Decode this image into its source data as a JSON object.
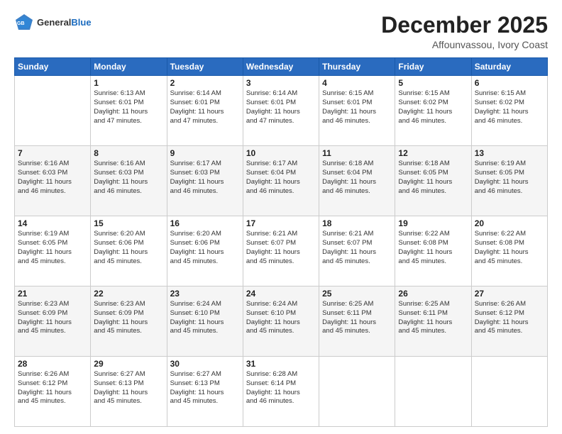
{
  "header": {
    "logo": {
      "general": "General",
      "blue": "Blue"
    },
    "title": "December 2025",
    "location": "Affounvassou, Ivory Coast"
  },
  "calendar": {
    "days_of_week": [
      "Sunday",
      "Monday",
      "Tuesday",
      "Wednesday",
      "Thursday",
      "Friday",
      "Saturday"
    ],
    "weeks": [
      [
        {
          "day": "",
          "info": ""
        },
        {
          "day": "1",
          "info": "Sunrise: 6:13 AM\nSunset: 6:01 PM\nDaylight: 11 hours\nand 47 minutes."
        },
        {
          "day": "2",
          "info": "Sunrise: 6:14 AM\nSunset: 6:01 PM\nDaylight: 11 hours\nand 47 minutes."
        },
        {
          "day": "3",
          "info": "Sunrise: 6:14 AM\nSunset: 6:01 PM\nDaylight: 11 hours\nand 47 minutes."
        },
        {
          "day": "4",
          "info": "Sunrise: 6:15 AM\nSunset: 6:01 PM\nDaylight: 11 hours\nand 46 minutes."
        },
        {
          "day": "5",
          "info": "Sunrise: 6:15 AM\nSunset: 6:02 PM\nDaylight: 11 hours\nand 46 minutes."
        },
        {
          "day": "6",
          "info": "Sunrise: 6:15 AM\nSunset: 6:02 PM\nDaylight: 11 hours\nand 46 minutes."
        }
      ],
      [
        {
          "day": "7",
          "info": "Sunrise: 6:16 AM\nSunset: 6:03 PM\nDaylight: 11 hours\nand 46 minutes."
        },
        {
          "day": "8",
          "info": "Sunrise: 6:16 AM\nSunset: 6:03 PM\nDaylight: 11 hours\nand 46 minutes."
        },
        {
          "day": "9",
          "info": "Sunrise: 6:17 AM\nSunset: 6:03 PM\nDaylight: 11 hours\nand 46 minutes."
        },
        {
          "day": "10",
          "info": "Sunrise: 6:17 AM\nSunset: 6:04 PM\nDaylight: 11 hours\nand 46 minutes."
        },
        {
          "day": "11",
          "info": "Sunrise: 6:18 AM\nSunset: 6:04 PM\nDaylight: 11 hours\nand 46 minutes."
        },
        {
          "day": "12",
          "info": "Sunrise: 6:18 AM\nSunset: 6:05 PM\nDaylight: 11 hours\nand 46 minutes."
        },
        {
          "day": "13",
          "info": "Sunrise: 6:19 AM\nSunset: 6:05 PM\nDaylight: 11 hours\nand 46 minutes."
        }
      ],
      [
        {
          "day": "14",
          "info": "Sunrise: 6:19 AM\nSunset: 6:05 PM\nDaylight: 11 hours\nand 45 minutes."
        },
        {
          "day": "15",
          "info": "Sunrise: 6:20 AM\nSunset: 6:06 PM\nDaylight: 11 hours\nand 45 minutes."
        },
        {
          "day": "16",
          "info": "Sunrise: 6:20 AM\nSunset: 6:06 PM\nDaylight: 11 hours\nand 45 minutes."
        },
        {
          "day": "17",
          "info": "Sunrise: 6:21 AM\nSunset: 6:07 PM\nDaylight: 11 hours\nand 45 minutes."
        },
        {
          "day": "18",
          "info": "Sunrise: 6:21 AM\nSunset: 6:07 PM\nDaylight: 11 hours\nand 45 minutes."
        },
        {
          "day": "19",
          "info": "Sunrise: 6:22 AM\nSunset: 6:08 PM\nDaylight: 11 hours\nand 45 minutes."
        },
        {
          "day": "20",
          "info": "Sunrise: 6:22 AM\nSunset: 6:08 PM\nDaylight: 11 hours\nand 45 minutes."
        }
      ],
      [
        {
          "day": "21",
          "info": "Sunrise: 6:23 AM\nSunset: 6:09 PM\nDaylight: 11 hours\nand 45 minutes."
        },
        {
          "day": "22",
          "info": "Sunrise: 6:23 AM\nSunset: 6:09 PM\nDaylight: 11 hours\nand 45 minutes."
        },
        {
          "day": "23",
          "info": "Sunrise: 6:24 AM\nSunset: 6:10 PM\nDaylight: 11 hours\nand 45 minutes."
        },
        {
          "day": "24",
          "info": "Sunrise: 6:24 AM\nSunset: 6:10 PM\nDaylight: 11 hours\nand 45 minutes."
        },
        {
          "day": "25",
          "info": "Sunrise: 6:25 AM\nSunset: 6:11 PM\nDaylight: 11 hours\nand 45 minutes."
        },
        {
          "day": "26",
          "info": "Sunrise: 6:25 AM\nSunset: 6:11 PM\nDaylight: 11 hours\nand 45 minutes."
        },
        {
          "day": "27",
          "info": "Sunrise: 6:26 AM\nSunset: 6:12 PM\nDaylight: 11 hours\nand 45 minutes."
        }
      ],
      [
        {
          "day": "28",
          "info": "Sunrise: 6:26 AM\nSunset: 6:12 PM\nDaylight: 11 hours\nand 45 minutes."
        },
        {
          "day": "29",
          "info": "Sunrise: 6:27 AM\nSunset: 6:13 PM\nDaylight: 11 hours\nand 45 minutes."
        },
        {
          "day": "30",
          "info": "Sunrise: 6:27 AM\nSunset: 6:13 PM\nDaylight: 11 hours\nand 45 minutes."
        },
        {
          "day": "31",
          "info": "Sunrise: 6:28 AM\nSunset: 6:14 PM\nDaylight: 11 hours\nand 46 minutes."
        },
        {
          "day": "",
          "info": ""
        },
        {
          "day": "",
          "info": ""
        },
        {
          "day": "",
          "info": ""
        }
      ]
    ]
  }
}
